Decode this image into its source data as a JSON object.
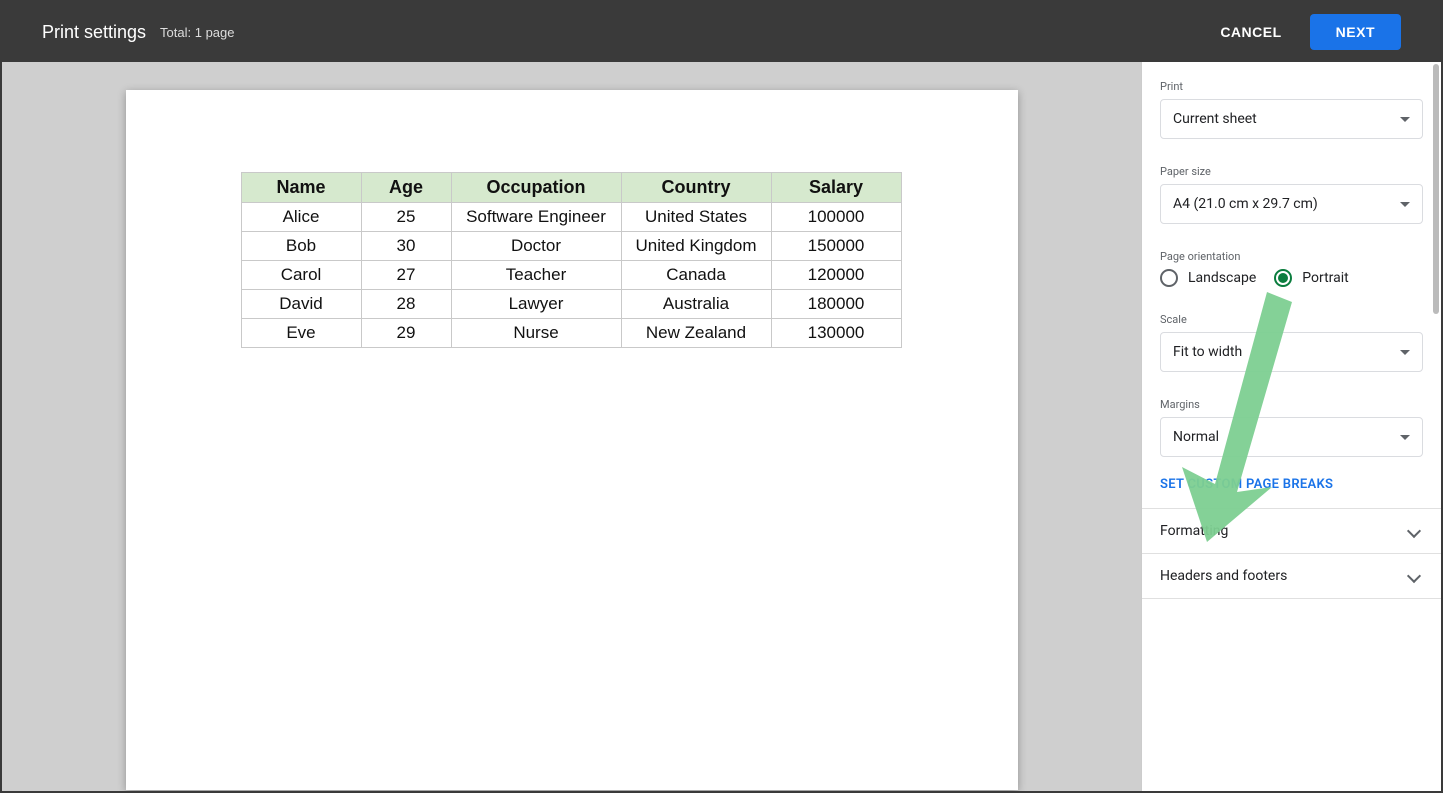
{
  "header": {
    "title": "Print settings",
    "subtitle": "Total: 1 page",
    "cancel": "CANCEL",
    "next": "NEXT"
  },
  "table": {
    "headers": [
      "Name",
      "Age",
      "Occupation",
      "Country",
      "Salary"
    ],
    "rows": [
      [
        "Alice",
        "25",
        "Software Engineer",
        "United States",
        "100000"
      ],
      [
        "Bob",
        "30",
        "Doctor",
        "United Kingdom",
        "150000"
      ],
      [
        "Carol",
        "27",
        "Teacher",
        "Canada",
        "120000"
      ],
      [
        "David",
        "28",
        "Lawyer",
        "Australia",
        "180000"
      ],
      [
        "Eve",
        "29",
        "Nurse",
        "New Zealand",
        "130000"
      ]
    ]
  },
  "sidebar": {
    "print_label": "Print",
    "print_value": "Current sheet",
    "paper_label": "Paper size",
    "paper_value": "A4 (21.0 cm x 29.7 cm)",
    "orient_label": "Page orientation",
    "landscape": "Landscape",
    "portrait": "Portrait",
    "scale_label": "Scale",
    "scale_value": "Fit to width",
    "margins_label": "Margins",
    "margins_value": "Normal",
    "page_breaks": "SET CUSTOM PAGE BREAKS",
    "formatting": "Formatting",
    "headers_footers": "Headers and footers"
  }
}
